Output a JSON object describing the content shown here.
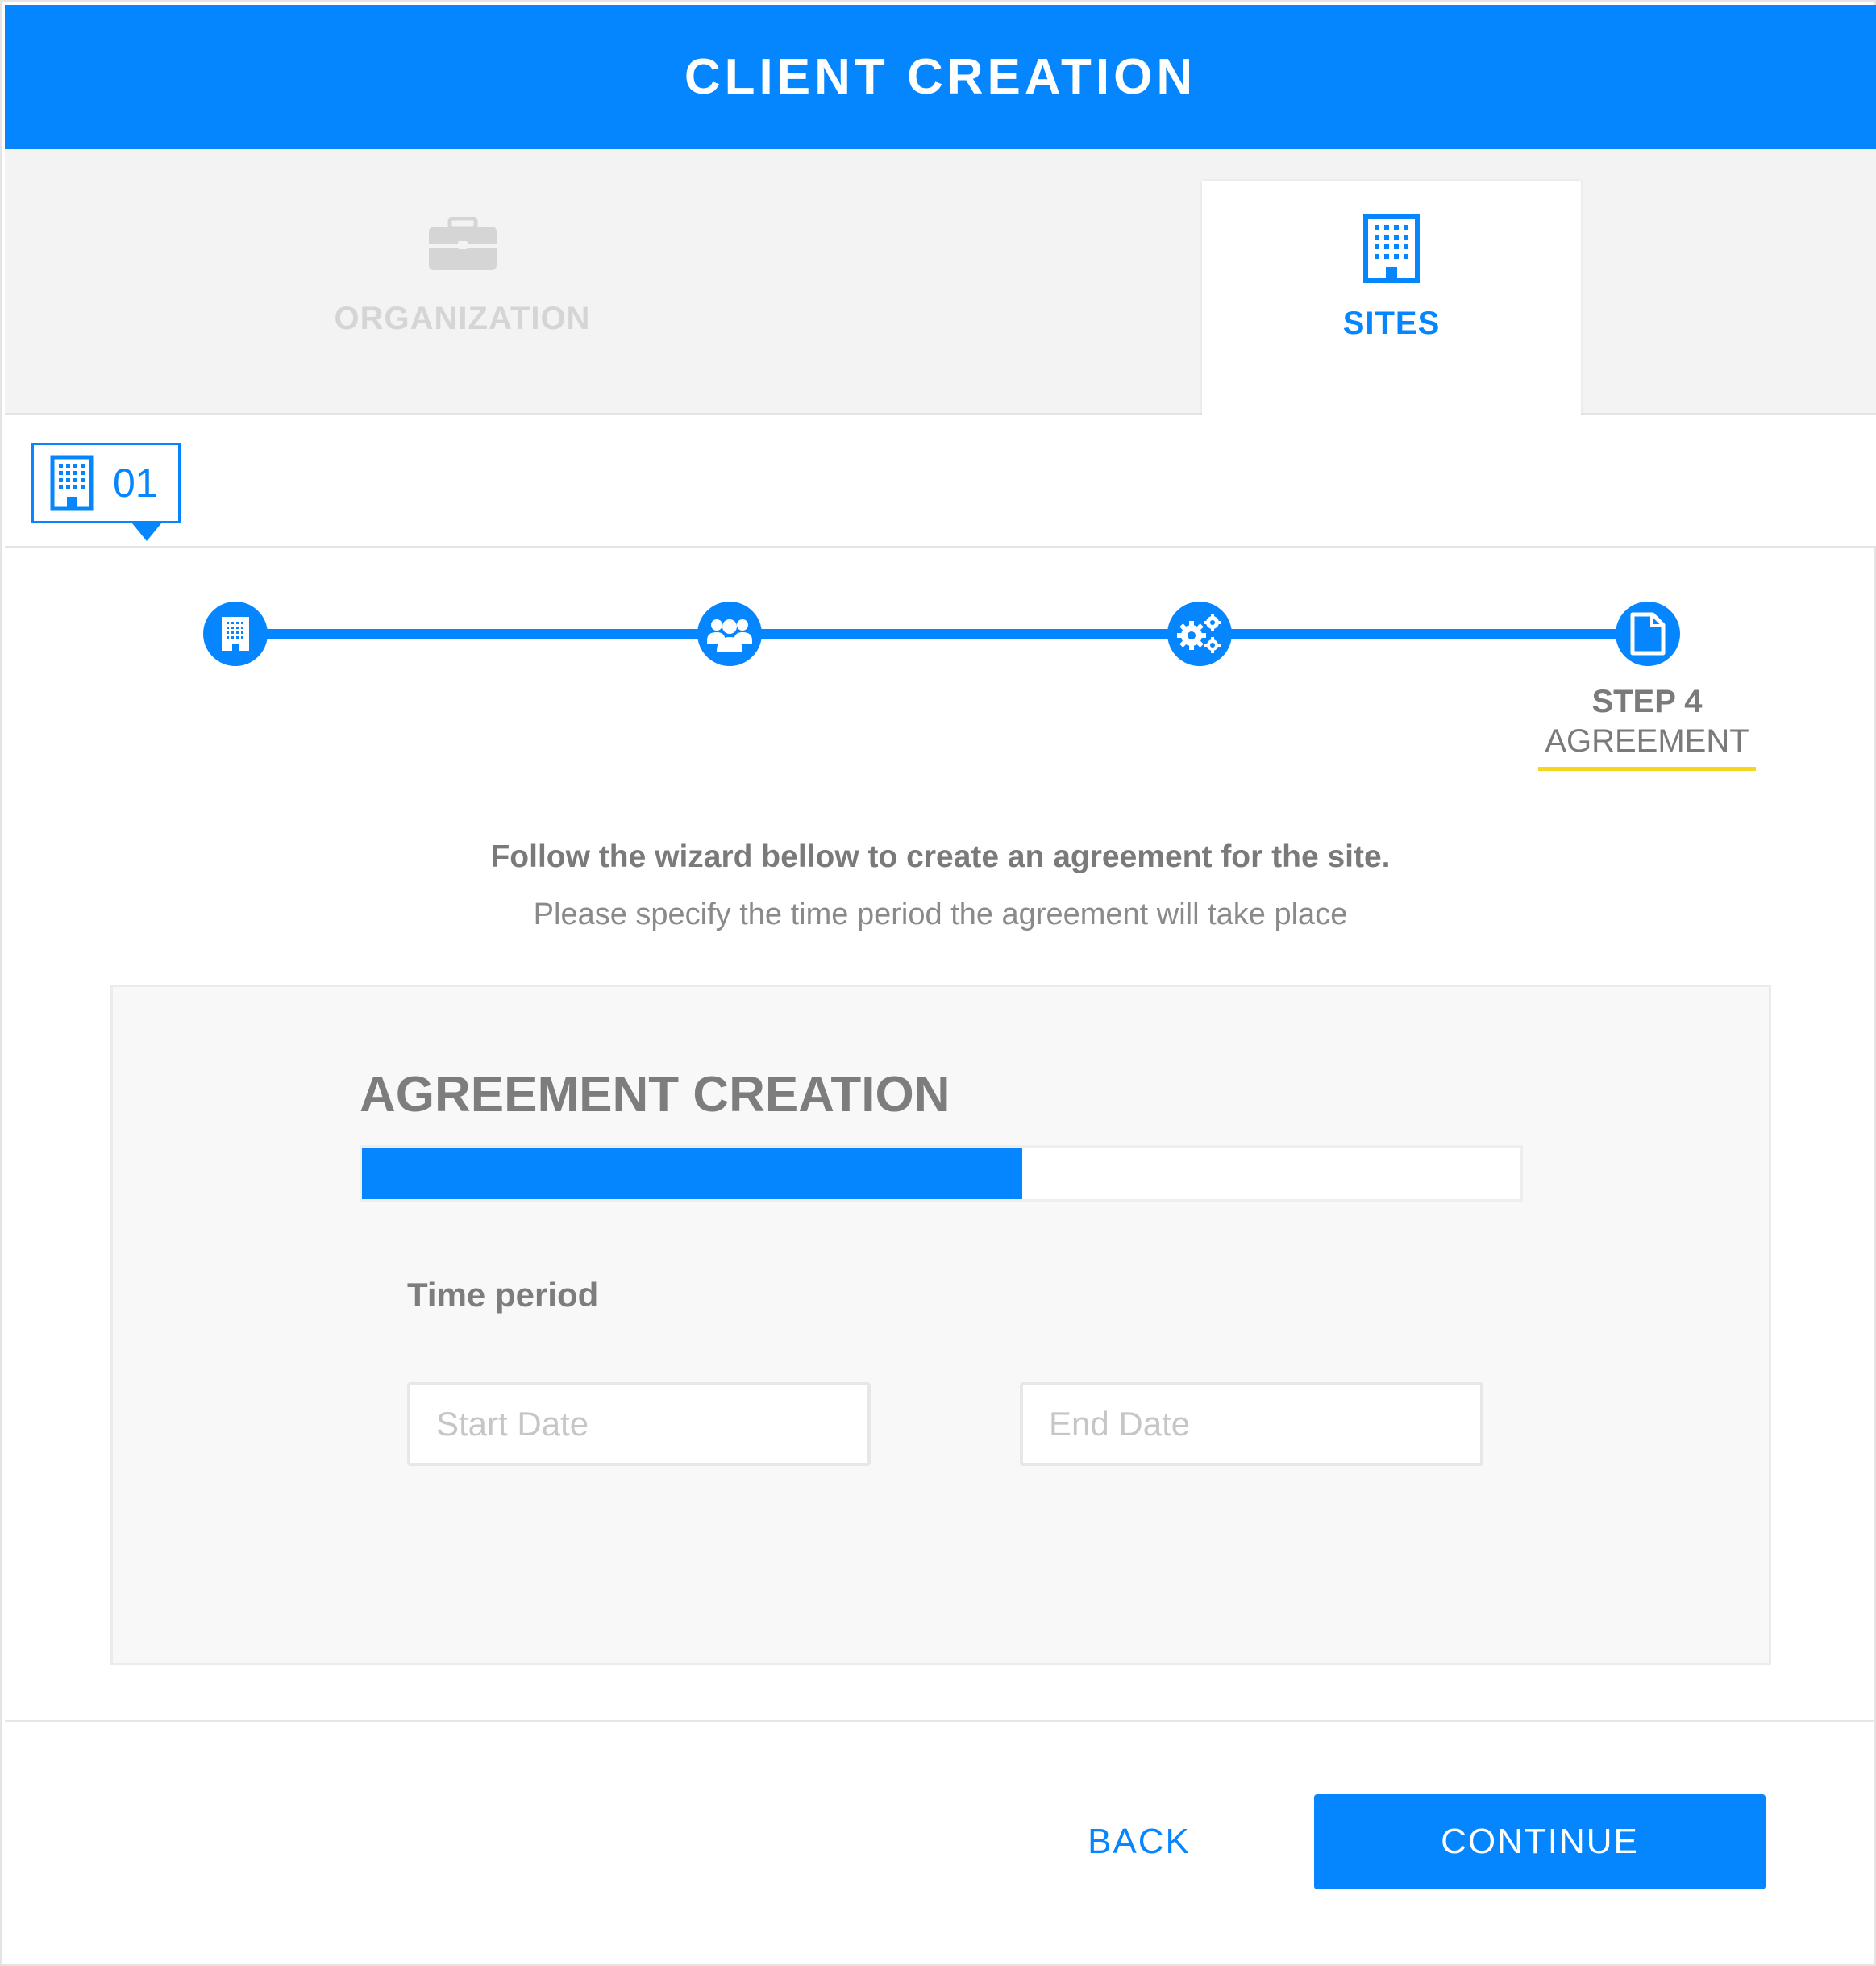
{
  "header": {
    "title": "CLIENT CREATION"
  },
  "tabs": [
    {
      "label": "ORGANIZATION",
      "icon": "briefcase-icon",
      "active": false
    },
    {
      "label": "SITES",
      "icon": "building-icon",
      "active": true
    }
  ],
  "site_selector": {
    "number": "01",
    "icon": "building-icon"
  },
  "stepper": {
    "steps": [
      {
        "icon": "building-icon"
      },
      {
        "icon": "users-icon"
      },
      {
        "icon": "gears-icon"
      },
      {
        "icon": "document-icon"
      }
    ],
    "current": {
      "step_label": "STEP 4",
      "name": "AGREEMENT"
    }
  },
  "intro": {
    "bold": "Follow the wizard bellow to create an agreement for the site.",
    "normal": "Please specify the time period the agreement will take place"
  },
  "card": {
    "title": "AGREEMENT CREATION",
    "progress_percent": 57,
    "time_period_label": "Time period",
    "start_date_placeholder": "Start Date",
    "end_date_placeholder": "End Date"
  },
  "footer": {
    "back_label": "BACK",
    "continue_label": "CONTINUE"
  },
  "colors": {
    "accent": "#0585fe",
    "highlight": "#f7d51d",
    "text": "#7a7a7a"
  }
}
